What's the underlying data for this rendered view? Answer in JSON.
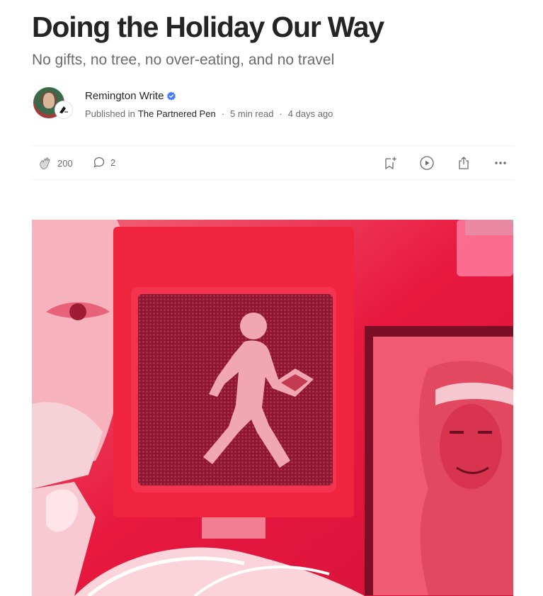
{
  "article": {
    "title": "Doing the Holiday Our Way",
    "subtitle": "No gifts, no tree, no over-eating, and no travel"
  },
  "author": {
    "name": "Remington Write",
    "published_prefix": "Published in",
    "publication": "The Partnered Pen",
    "separator": "·",
    "read_time": "5 min read",
    "date": "4 days ago",
    "verified_color": "#437aff"
  },
  "actions": {
    "claps": "200",
    "responses": "2",
    "icons": [
      "clap-icon",
      "response-icon",
      "bookmark-add-icon",
      "play-icon",
      "share-icon",
      "more-icon"
    ]
  },
  "hero_image": {
    "description_icon": "walk-signal-photo",
    "dominant_color": "#e81f43"
  }
}
